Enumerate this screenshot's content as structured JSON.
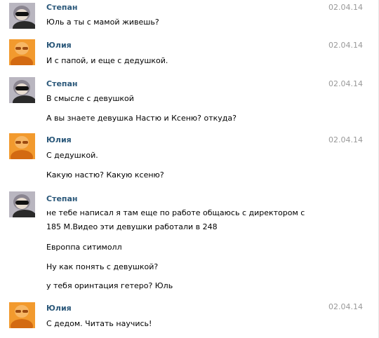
{
  "messages": [
    {
      "author": "Степан",
      "date": "02.04.14",
      "avatar": "stepan-avatar",
      "lines": [
        "Юль а ты с мамой живешь?"
      ]
    },
    {
      "author": "Юлия",
      "date": "02.04.14",
      "avatar": "yulia-avatar",
      "lines": [
        "И с папой, и еще с дедушкой."
      ]
    },
    {
      "author": "Степан",
      "date": "02.04.14",
      "avatar": "stepan-avatar",
      "lines": [
        "В смысле с девушкой",
        "А вы знаете девушка Настю и Ксеню? откуда?"
      ]
    },
    {
      "author": "Юлия",
      "date": "02.04.14",
      "avatar": "yulia-avatar",
      "lines": [
        "С дедушкой.",
        "Какую настю? Какую ксеню?"
      ]
    },
    {
      "author": "Степан",
      "date": "",
      "avatar": "stepan-avatar",
      "lines": [
        "не тебе написал я там еще по работе общаюсь с директором с",
        "185 М.Видео эти девушки работали в 248",
        "Европпа ситимолл",
        "Ну как понять с девушкой?",
        "у тебя оринтация гетеро? Юль"
      ]
    },
    {
      "author": "Юлия",
      "date": "02.04.14",
      "avatar": "yulia-avatar",
      "lines": [
        "С дедом. Читать научись!"
      ]
    }
  ],
  "colors": {
    "author": "#2b587a",
    "date": "#999999",
    "text": "#000000"
  }
}
